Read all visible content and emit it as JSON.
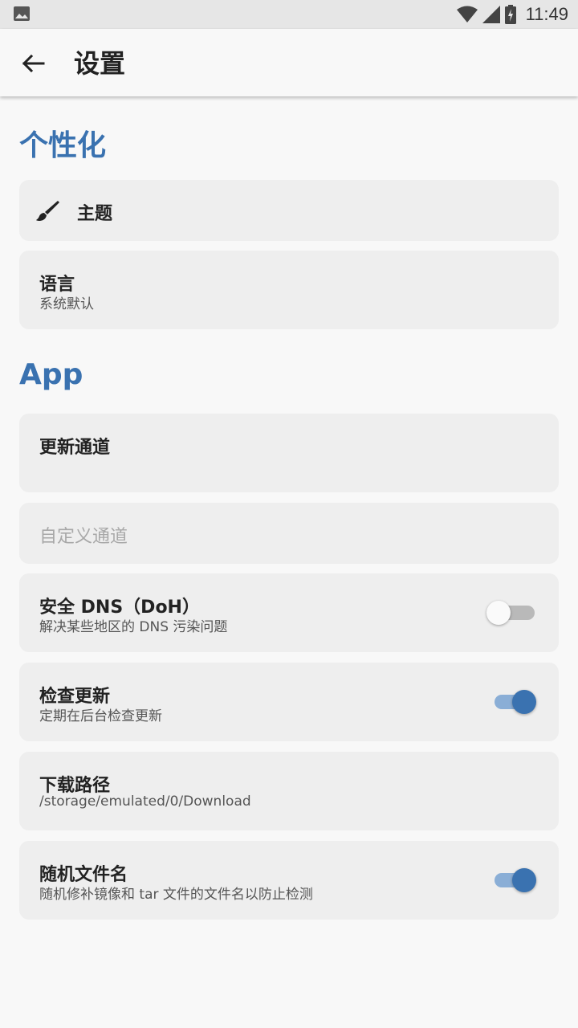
{
  "status_bar": {
    "time": "11:49"
  },
  "app_bar": {
    "title": "设置"
  },
  "sections": {
    "personalization": {
      "header": "个性化",
      "theme": {
        "title": "主题"
      },
      "language": {
        "title": "语言",
        "subtitle": "系统默认"
      }
    },
    "app": {
      "header": "App",
      "update_channel": {
        "title": "更新通道"
      },
      "custom_channel": {
        "title": "自定义通道"
      },
      "secure_dns": {
        "title": "安全 DNS（DoH）",
        "subtitle": "解决某些地区的 DNS 污染问题",
        "enabled": false
      },
      "check_update": {
        "title": "检查更新",
        "subtitle": "定期在后台检查更新",
        "enabled": true
      },
      "download_path": {
        "title": "下载路径",
        "subtitle": "/storage/emulated/0/Download"
      },
      "random_filename": {
        "title": "随机文件名",
        "subtitle": "随机修补镜像和 tar 文件的文件名以防止检测",
        "enabled": true
      }
    }
  },
  "colors": {
    "accent": "#3a72b0",
    "card": "#eeeeee",
    "background": "#f8f8f8"
  },
  "icons": [
    "gallery-icon",
    "wifi-icon",
    "signal-icon",
    "battery-charging-icon",
    "back-arrow-icon",
    "brush-icon"
  ]
}
